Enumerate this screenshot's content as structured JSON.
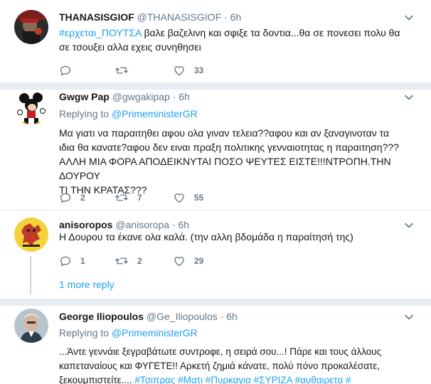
{
  "tweets": [
    {
      "name": "THANASISGIOF",
      "handle": "@THANASISGIOF",
      "dot": "·",
      "time": "6h",
      "text_hashtag": "#ερχεται_ΠΟΥΤΣΑ",
      "text_line1_rest": " βαλε βαζελινη και σφιξε τα δοντια...θα σε πονεσει πολυ θα",
      "text_line2": "σε τσουξει αλλα εχεις συνηθησει",
      "reply_count": "",
      "retweet_count": "",
      "like_count": "33"
    },
    {
      "name": "Gwgw Pap",
      "handle": "@gwgakipap",
      "dot": "·",
      "time": "6h",
      "replying_prefix": "Replying to ",
      "replying_to": "@PrimeministerGR",
      "lines": [
        "Μα γιατι να παραιτηθει αφου ολα γιναν τελεια??αφου και αν ξαναγινοταν τα",
        "ιδια θα κανατε?αφου δεν ειναι πραξη πολιτικης γενναιοτητας η παραιτηση???",
        "ΑΛΛΗ ΜΙΑ ΦΟΡΑ ΑΠΟΔΕΙΚΝΥΤΑΙ ΠΟΣΟ ΨΕΥΤΕΣ ΕΙΣΤΕ!!!ΝΤΡΟΠΗ.ΤΗΝ ΔΟΥΡΟΥ",
        "ΤΙ ΤΗΝ ΚΡΑΤΑΣ???"
      ],
      "reply_count": "2",
      "retweet_count": "7",
      "like_count": "55"
    },
    {
      "name": "anisoropos",
      "handle": "@anisoropa",
      "dot": "·",
      "time": "6h",
      "text": "Η Δουρου τα έκανε ολα καλά. (την αλλη βδομάδα η παραίτησή της)",
      "reply_count": "1",
      "retweet_count": "2",
      "like_count": "29"
    },
    {
      "name": "George Iliopoulos",
      "handle": "@Ge_Iliopoulos",
      "dot": "·",
      "time": "6h",
      "replying_prefix": "Replying to ",
      "replying_to": "@PrimeministerGR",
      "line1": "...Άντε γεννάιε ξεγραβάτωτε συντροφε, η σειρά σου...! Πάρε και τους άλλους",
      "line2": "καπεταναίους και ΦΥΓΕΤΕ!! Αρκετή ζημιά κάνατε, πολύ πόνο προκαλέσατε,",
      "line3_text": "ξεκουμπιστείτε.... ",
      "line3_hashtags": "#Τσιπρας #Ματι #Πυρκαγια #ΣΥΡΙΖΑ #αυθαιρετα #"
    }
  ],
  "more_replies": "1 more reply",
  "colors": {
    "accent": "#1da1f2",
    "muted": "#657786",
    "divider": "#e6ecf0",
    "thread_line": "#ccd6dd"
  },
  "icons": [
    "reply-icon",
    "retweet-icon",
    "like-icon",
    "chevron-down-icon"
  ]
}
